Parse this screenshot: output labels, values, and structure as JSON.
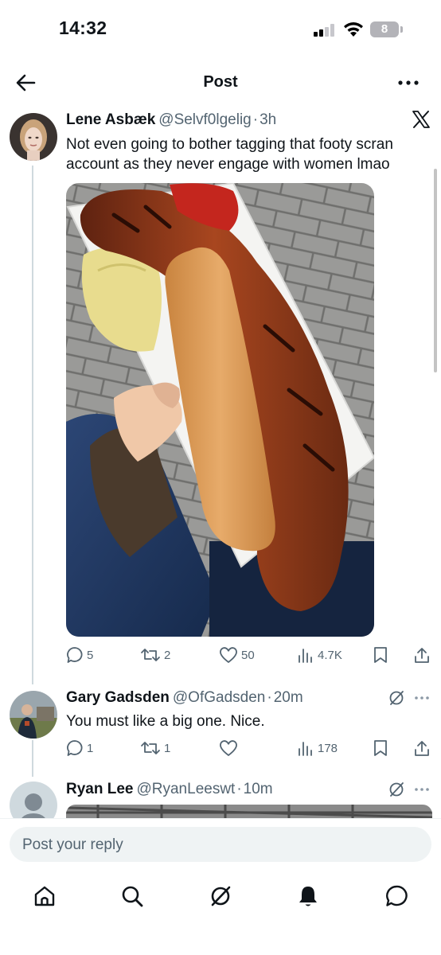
{
  "status_bar": {
    "time": "14:32",
    "battery": "8"
  },
  "header": {
    "title": "Post"
  },
  "main_post": {
    "author_name": "Lene Asbæk",
    "handle": "@Selvf0lgelig",
    "time": "3h",
    "text": "Not even going to bother tagging that footy scran account as they never engage with women lmao",
    "replies": "5",
    "reposts": "2",
    "likes": "50",
    "views": "4.7K"
  },
  "replies": [
    {
      "author_name": "Gary Gadsden",
      "handle": "@OfGadsden",
      "time": "20m",
      "text": "You must like a big one. Nice.",
      "replies": "1",
      "reposts": "1",
      "likes": "",
      "views": "178"
    },
    {
      "author_name": "Ryan Lee",
      "handle": "@RyanLeeswt",
      "time": "10m"
    }
  ],
  "reply_box": {
    "placeholder": "Post your reply"
  },
  "icons": {
    "back": "arrow-left-icon",
    "more": "more-horizontal-icon",
    "reply": "speech-bubble-icon",
    "repost": "repost-icon",
    "like": "heart-icon",
    "views": "bar-chart-icon",
    "bookmark": "bookmark-icon",
    "share": "share-icon",
    "grok": "grok-icon",
    "x": "x-logo-icon",
    "home": "home-icon",
    "search": "search-icon",
    "notifications": "bell-icon",
    "messages": "chat-bubble-icon"
  },
  "colors": {
    "text": "#0f1419",
    "secondary": "#536471",
    "thread_line": "#cfd9de",
    "input_bg": "#eff3f4"
  }
}
